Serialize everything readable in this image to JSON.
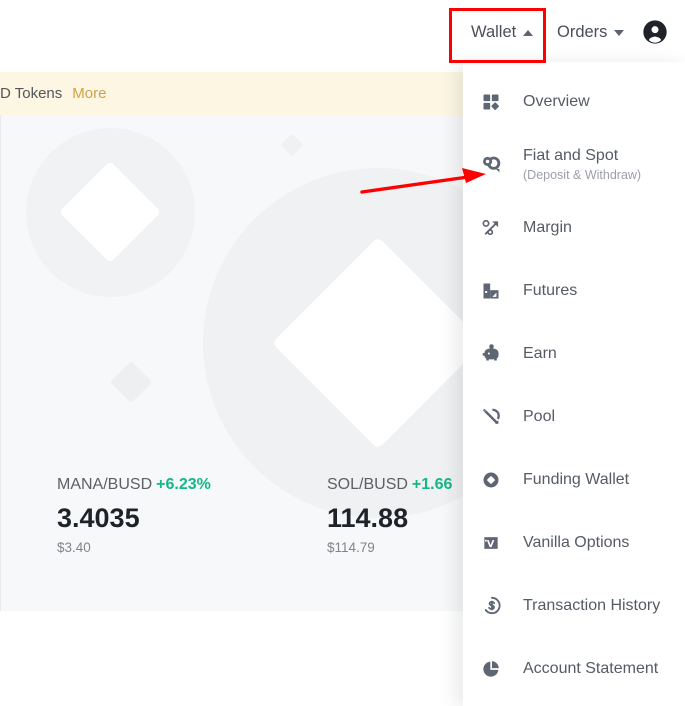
{
  "nav": {
    "wallet": {
      "label": "Wallet",
      "icon": "caret-up-icon",
      "expanded": true
    },
    "orders": {
      "label": "Orders",
      "icon": "caret-down-icon",
      "expanded": false
    },
    "account_icon": "account-circle-icon"
  },
  "annotations": {
    "highlight_color": "#ff0000",
    "box_target": "Wallet",
    "arrow_target": "Fiat and Spot"
  },
  "banner": {
    "text": "D Tokens",
    "more_label": "More",
    "background": "#fdf6e3",
    "link_color": "#cda349"
  },
  "tickers": [
    {
      "pair": "MANA/BUSD",
      "change": "+6.23%",
      "price": "3.4035",
      "fiat": "$3.40",
      "change_color": "#12b886"
    },
    {
      "pair": "SOL/BUSD",
      "change": "+1.66",
      "price": "114.88",
      "fiat": "$114.79",
      "change_color": "#12b886"
    }
  ],
  "wallet_menu": {
    "items": [
      {
        "label": "Overview",
        "sub": "",
        "icon": "grid-overview-icon"
      },
      {
        "label": "Fiat and Spot",
        "sub": "(Deposit & Withdraw)",
        "icon": "coins-fiat-spot-icon"
      },
      {
        "label": "Margin",
        "sub": "",
        "icon": "percent-arrow-margin-icon"
      },
      {
        "label": "Futures",
        "sub": "",
        "icon": "bar-chart-futures-icon"
      },
      {
        "label": "Earn",
        "sub": "",
        "icon": "piggy-bank-earn-icon"
      },
      {
        "label": "Pool",
        "sub": "",
        "icon": "pickaxe-pool-icon"
      },
      {
        "label": "Funding Wallet",
        "sub": "",
        "icon": "diamond-circle-funding-icon"
      },
      {
        "label": "Vanilla Options",
        "sub": "",
        "icon": "v-badge-options-icon"
      },
      {
        "label": "Transaction History",
        "sub": "",
        "icon": "dollar-clock-history-icon"
      },
      {
        "label": "Account Statement",
        "sub": "",
        "icon": "pie-chart-statement-icon"
      }
    ]
  }
}
